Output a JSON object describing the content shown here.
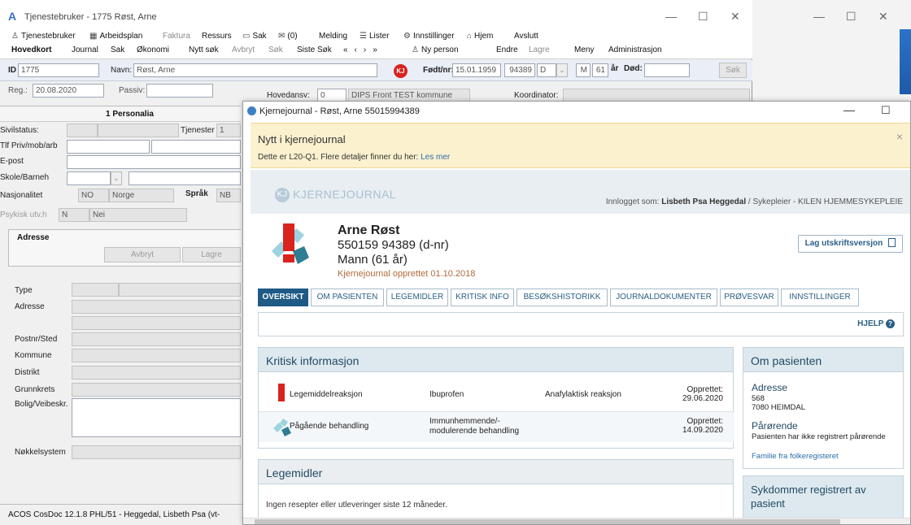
{
  "back_window": {
    "title": "Tjenestebruker - 1775 Røst, Arne",
    "menu_row1": [
      "Tjenestebruker",
      "Arbeidsplan",
      "Faktura",
      "Ressurs",
      "Sak",
      "(0)",
      "Melding",
      "Lister",
      "Innstillinger",
      "Hjem",
      "Avslutt"
    ],
    "menu_row2": [
      "Hovedkort",
      "Journal",
      "Sak",
      "Økonomi",
      "Nytt søk",
      "Avbryt",
      "Søk",
      "Siste Søk",
      "Ny person",
      "Endre",
      "Lagre",
      "Meny",
      "Administrasjon"
    ],
    "id_label": "ID",
    "id_value": "1775",
    "navn_label": "Navn:",
    "navn_value": "Røst, Arne",
    "fodt_label": "Født/nr:",
    "fodt_value": "15.01.1959",
    "pnr_value": "94389",
    "d_value": "D",
    "sex_value": "M",
    "age_value": "61",
    "age_unit": "år",
    "dod_label": "Død:",
    "sok_button": "Søk",
    "reg_label": "Reg.:",
    "reg_value": "20.08.2020",
    "passiv_label": "Passiv:",
    "hovedansv_label": "Hovedansv:",
    "hovedansv_value": "0",
    "dips_value": "DIPS Front TEST kommune",
    "koordinator_label": "Koordinator:",
    "personalia_tab": "1 Personalia",
    "fields": {
      "sivilstatus": "Sivilstatus:",
      "tjenester": "Tjenester",
      "tjenester_value": "1",
      "tlf": "Tlf Priv/mob/arb",
      "epost": "E-post",
      "skole": "Skole/Barneh",
      "nasjonalitet": "Nasjonalitet",
      "nasj_code": "NO",
      "nasj_value": "Norge",
      "sprak": "Språk",
      "sprak_value": "NB",
      "psykisk": "Psykisk utv.h",
      "psykisk_code": "N",
      "psykisk_value": "Nei"
    },
    "adresse_tab": "Adresse",
    "avbryt": "Avbryt",
    "lagre": "Lagre",
    "addr_fields": [
      "Type",
      "Adresse",
      "Postnr/Sted",
      "Kommune",
      "Distrikt",
      "Grunnkrets",
      "Bolig/Veibeskr.",
      "Nøkkelsystem"
    ],
    "status": "ACOS CosDoc 12.1.8   PHL/51 - Heggedal, Lisbeth Psa (vt-"
  },
  "kj_window": {
    "title": "Kjernejournal - Røst, Arne 55015994389",
    "notice_title": "Nytt i kjernejournal",
    "notice_text": "Dette er L20-Q1. Flere detaljer finner du her:",
    "notice_link": "Les mer",
    "logo_text": "KJERNEJOURNAL",
    "logo_mark": "KJ",
    "logged_in_prefix": "Innlogget som:",
    "logged_in_user": "Lisbeth Psa Heggedal",
    "logged_in_suffix": "/ Sykepleier - KILEN HJEMMESYKEPLEIE",
    "patient": {
      "name": "Arne Røst",
      "id": "550159 94389 (d-nr)",
      "sex_age": "Mann (61 år)",
      "created": "Kjernejournal opprettet 01.10.2018"
    },
    "print_button": "Lag utskriftsversjon",
    "tabs": [
      "OVERSIKT",
      "OM PASIENTEN",
      "LEGEMIDLER",
      "KRITISK INFO",
      "BESØKSHISTORIKK",
      "JOURNALDOKUMENTER",
      "PRØVESVAR",
      "INNSTILLINGER"
    ],
    "help": "HJELP",
    "critical": {
      "title": "Kritisk informasjon",
      "rows": [
        {
          "type": "Legemiddelreaksjon",
          "agent": "Ibuprofen",
          "reaction": "Anafylaktisk reaksjon",
          "created_label": "Opprettet:",
          "created": "29.06.2020"
        },
        {
          "type": "Pågående behandling",
          "agent": "Immunhemmende/-\nmodulerende behandling",
          "reaction": "",
          "created_label": "Opprettet:",
          "created": "14.09.2020"
        }
      ]
    },
    "legemidler": {
      "title": "Legemidler",
      "none_text": "Ingen resepter eller utleveringer siste 12 måneder."
    },
    "om_pasienten": {
      "title": "Om pasienten",
      "adresse_label": "Adresse",
      "adresse_line1": "568",
      "adresse_line2": "7080 HEIMDAL",
      "parorende_label": "Pårørende",
      "parorende_text": "Pasienten har ikke registrert pårørende",
      "familie_link": "Familie fra folkeregisteret"
    },
    "sykdommer_title": "Sykdommer registrert av pasient"
  },
  "colors": {
    "accent": "#1f5a86",
    "notice_bg": "#fbf1cf",
    "critical_red": "#d9231d",
    "teal": "#2f7d92"
  }
}
